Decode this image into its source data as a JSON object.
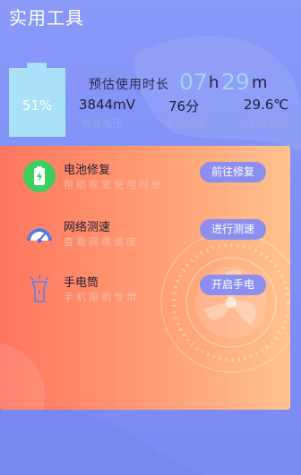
{
  "page_title": "实用工具",
  "battery": {
    "percent_text": "51%",
    "level_fraction": 0.51
  },
  "estimate": {
    "label": "预估使用时长",
    "hours": "07",
    "hours_unit": "h",
    "minutes": "29",
    "minutes_unit": "m"
  },
  "stats": [
    {
      "value": "3844mV",
      "label": "电池电压"
    },
    {
      "value": "76分",
      "label": "电池状态"
    },
    {
      "value": "29.6℃",
      "label": "电池温度"
    }
  ],
  "tools": [
    {
      "title": "电池修复",
      "subtitle": "帮助恢复使用时长",
      "button": "前往修复",
      "icon": "battery-repair-icon"
    },
    {
      "title": "网络测速",
      "subtitle": "查看网络速度",
      "button": "进行测速",
      "icon": "speedometer-icon"
    },
    {
      "title": "手电筒",
      "subtitle": "手机照明专用",
      "button": "开启手电",
      "icon": "flashlight-icon"
    }
  ],
  "colors": {
    "background": "#8a99f8",
    "card_start": "#ff7560",
    "card_end": "#ffc28f",
    "button": "#8d8ff0",
    "battery": "#a9e1f8",
    "time_digits": "#a0d4f4",
    "green_icon": "#3ccf5f"
  }
}
